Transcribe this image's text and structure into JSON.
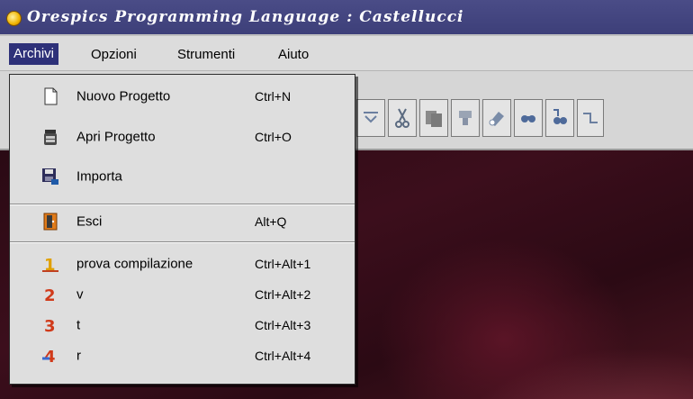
{
  "window": {
    "title": "Orespics Programming Language : Castellucci"
  },
  "menubar": {
    "items": [
      {
        "label": "Archivi",
        "active": true
      },
      {
        "label": "Opzioni"
      },
      {
        "label": "Strumenti"
      },
      {
        "label": "Aiuto"
      }
    ]
  },
  "archivi_menu": {
    "items": [
      {
        "label": "Nuovo Progetto",
        "shortcut": "Ctrl+N",
        "icon": "new-document-icon"
      },
      {
        "label": "Apri Progetto",
        "shortcut": "Ctrl+O",
        "icon": "open-project-icon"
      },
      {
        "label": "Importa",
        "shortcut": "",
        "icon": "import-disk-icon"
      },
      {
        "label": "Esci",
        "shortcut": "Alt+Q",
        "icon": "exit-door-icon"
      },
      {
        "label": "prova compilazione",
        "shortcut": "Ctrl+Alt+1",
        "icon": "recent-1-icon"
      },
      {
        "label": "v",
        "shortcut": "Ctrl+Alt+2",
        "icon": "recent-2-icon"
      },
      {
        "label": "t",
        "shortcut": "Ctrl+Alt+3",
        "icon": "recent-3-icon"
      },
      {
        "label": "r",
        "shortcut": "Ctrl+Alt+4",
        "icon": "recent-4-icon"
      }
    ]
  },
  "toolbar": {
    "buttons": [
      {
        "icon": "undo-icon"
      },
      {
        "icon": "cut-icon"
      },
      {
        "icon": "copy-icon"
      },
      {
        "icon": "paste-icon"
      },
      {
        "icon": "eraser-icon"
      },
      {
        "icon": "find-icon"
      },
      {
        "icon": "find-replace-icon"
      },
      {
        "icon": "connector-icon"
      }
    ]
  },
  "colors": {
    "titlebar": "#3d3f79",
    "menu_highlight": "#2e3179",
    "menu_bg": "#dedede"
  }
}
